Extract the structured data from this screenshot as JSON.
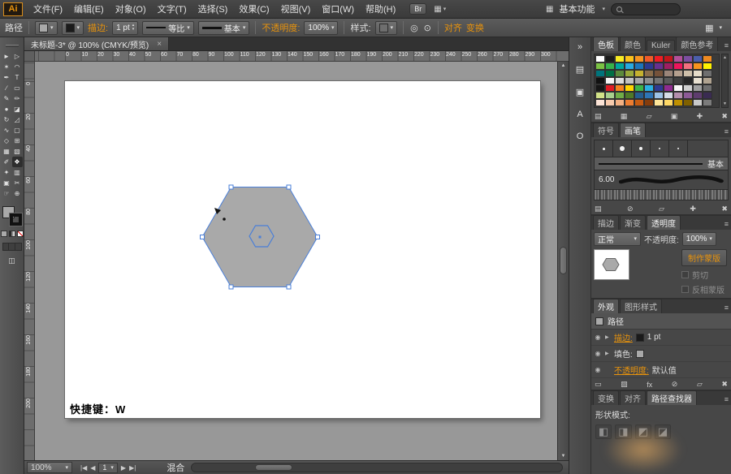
{
  "colors": {
    "accent_orange": "#e8930c",
    "selection_blue": "#4a7fd8",
    "pasteboard_gray": "#989898",
    "artboard_white": "#ffffff"
  },
  "icons": {
    "caret_down": "▾",
    "caret_up": "▴",
    "grid": "▦",
    "menu": "≡",
    "close": "×",
    "eye": "◉",
    "disclosure": "▶",
    "nav_first": "|◀",
    "nav_prev": "◀",
    "nav_next": "▶",
    "nav_last": "▶|",
    "scroll_up": "▲",
    "scroll_down": "▼",
    "isolate": "◎",
    "recolor": "⊙",
    "screen_mode": "◫"
  },
  "menubar": {
    "logo": "Ai",
    "items": [
      "文件(F)",
      "编辑(E)",
      "对象(O)",
      "文字(T)",
      "选择(S)",
      "效果(C)",
      "视图(V)",
      "窗口(W)",
      "帮助(H)"
    ],
    "br_button": "Br",
    "workspace": "基本功能"
  },
  "controlbar": {
    "context_label": "路径",
    "fill_swatch": "#a9a9a9",
    "stroke_swatch": "#1a1a1a",
    "stroke_label": "描边:",
    "stroke_weight": "1 pt",
    "profile_label": "等比",
    "brush_label": "基本",
    "opacity_label": "不透明度:",
    "opacity_value": "100%",
    "style_label": "样式:",
    "align_label": "对齐",
    "transform_label": "变换"
  },
  "toolbar": {
    "tools": [
      {
        "name": "selection-tool",
        "glyph": "►"
      },
      {
        "name": "direct-selection-tool",
        "glyph": "▷"
      },
      {
        "name": "magic-wand-tool",
        "glyph": "✶"
      },
      {
        "name": "lasso-tool",
        "glyph": "◠"
      },
      {
        "name": "pen-tool",
        "glyph": "✒"
      },
      {
        "name": "type-tool",
        "glyph": "T"
      },
      {
        "name": "line-segment-tool",
        "glyph": "∕"
      },
      {
        "name": "rectangle-tool",
        "glyph": "▭"
      },
      {
        "name": "paintbrush-tool",
        "glyph": "✎"
      },
      {
        "name": "pencil-tool",
        "glyph": "✏"
      },
      {
        "name": "blob-brush-tool",
        "glyph": "●"
      },
      {
        "name": "eraser-tool",
        "glyph": "◪"
      },
      {
        "name": "rotate-tool",
        "glyph": "↻"
      },
      {
        "name": "scale-tool",
        "glyph": "◿"
      },
      {
        "name": "width-tool",
        "glyph": "∿"
      },
      {
        "name": "free-transform-tool",
        "glyph": "▢"
      },
      {
        "name": "shape-builder-tool",
        "glyph": "◇"
      },
      {
        "name": "perspective-grid-tool",
        "glyph": "⊞"
      },
      {
        "name": "mesh-tool",
        "glyph": "▦"
      },
      {
        "name": "gradient-tool",
        "glyph": "▧"
      },
      {
        "name": "eyedropper-tool",
        "glyph": "✐"
      },
      {
        "name": "blend-tool",
        "glyph": "❖",
        "active": true
      },
      {
        "name": "symbol-sprayer-tool",
        "glyph": "✦"
      },
      {
        "name": "column-graph-tool",
        "glyph": "▥"
      },
      {
        "name": "artboard-tool",
        "glyph": "▣"
      },
      {
        "name": "slice-tool",
        "glyph": "✂"
      },
      {
        "name": "hand-tool",
        "glyph": "☞"
      },
      {
        "name": "zoom-tool",
        "glyph": "⊕"
      }
    ]
  },
  "document": {
    "tab_title": "未标题-3* @ 100% (CMYK/预览)",
    "shortcut_note": "快捷键：W",
    "hruler_numbers": [
      "0",
      "10",
      "20",
      "30",
      "40",
      "50",
      "60",
      "70",
      "80",
      "90",
      "100",
      "110",
      "120",
      "130",
      "140",
      "150",
      "160",
      "170",
      "180",
      "190",
      "200",
      "210",
      "220",
      "230",
      "240",
      "250",
      "260",
      "270",
      "280",
      "290",
      "300"
    ],
    "vruler_numbers": [
      "0",
      "20",
      "40",
      "60",
      "80",
      "100",
      "120",
      "140",
      "160",
      "180",
      "200"
    ]
  },
  "canvas": {
    "hexagon_fill": "#a9a9a9",
    "selection_color": "#4a7fd8",
    "cursor_color": "#111111"
  },
  "statusbar": {
    "zoom": "100%",
    "artboard_number": "1",
    "status_text": "混合"
  },
  "dock": {
    "strip_icons": [
      {
        "name": "expand-dock-icon",
        "glyph": "»"
      },
      {
        "name": "color-panel-icon",
        "glyph": "▤"
      },
      {
        "name": "brushes-panel-icon",
        "glyph": "▣"
      },
      {
        "name": "appearance-panel-icon",
        "glyph": "A"
      },
      {
        "name": "stroke-panel-icon",
        "glyph": "O"
      }
    ],
    "swatches": {
      "tabs": [
        "色板",
        "颜色",
        "Kuler",
        "颜色参考"
      ],
      "active_tab": "色板",
      "rows": [
        [
          "#ffffff",
          "#1c1c1c",
          "#f8ec24",
          "#fcc21b",
          "#f79422",
          "#f05a28",
          "#ee1d23",
          "#c2161b",
          "#b35099",
          "#7c4ea0",
          "#4b5fac",
          "#ee8a21"
        ],
        [
          "#7ac143",
          "#37b34a",
          "#00a79e",
          "#28aae1",
          "#1c75bb",
          "#2b3991",
          "#66308f",
          "#9e1e62",
          "#ed155b",
          "#f2707e",
          "#f7941e",
          "#fff200"
        ],
        [
          "#00747c",
          "#006f45",
          "#5c8a3c",
          "#98a83b",
          "#c5b12f",
          "#8a6d4b",
          "#75523a",
          "#9b8579",
          "#b5a08f",
          "#cebfa9",
          "#e7ddc9",
          "#6f6f6f"
        ],
        [
          "#111111",
          "#f5f5f5",
          "#dcdcdc",
          "#c2c2c2",
          "#a8a8a8",
          "#8e8e8e",
          "#747474",
          "#5a5a5a",
          "#404040",
          "#262626",
          "#e8e0d0",
          "#b0a390"
        ],
        [
          "#161616",
          "#e01b24",
          "#f58220",
          "#ffd400",
          "#3cb44a",
          "#2bb0e3",
          "#2e3a92",
          "#8f2b90",
          "#f9f9f9",
          "#cfcfcf",
          "#9f9f9f",
          "#6f6f6f"
        ],
        [
          "#d2e288",
          "#a8d08d",
          "#70ad47",
          "#4f7a28",
          "#255e91",
          "#2e75b6",
          "#9dc3e6",
          "#d6dce5",
          "#b48ead",
          "#8d5a97",
          "#5e3c6e",
          "#3a2b52"
        ],
        [
          "#fbe3d6",
          "#f8cbad",
          "#f4b183",
          "#ed7d31",
          "#c55a11",
          "#843c0c",
          "#ffe699",
          "#ffd966",
          "#bf9000",
          "#7f6000",
          "#c9c9c9",
          "#7b7b7b"
        ]
      ],
      "footer_icons": [
        {
          "name": "swatch-libraries-icon",
          "glyph": "▤"
        },
        {
          "name": "swatch-kinds-icon",
          "glyph": "▦"
        },
        {
          "name": "swatch-options-icon",
          "glyph": "▱"
        },
        {
          "name": "new-color-group-icon",
          "glyph": "▣"
        },
        {
          "name": "new-swatch-icon",
          "glyph": "✚"
        },
        {
          "name": "delete-swatch-icon",
          "glyph": "✖"
        }
      ]
    },
    "brushes": {
      "tabs": [
        "符号",
        "画笔"
      ],
      "active_tab": "画笔",
      "dot_sizes": [
        3,
        6,
        4,
        2,
        2
      ],
      "selected_brush": "基本",
      "calligraphic_brush": "6.00",
      "footer_icons": [
        {
          "name": "brush-libraries-icon",
          "glyph": "▤"
        },
        {
          "name": "remove-brush-stroke-icon",
          "glyph": "⊘"
        },
        {
          "name": "brush-options-icon",
          "glyph": "▱"
        },
        {
          "name": "new-brush-icon",
          "glyph": "✚"
        },
        {
          "name": "delete-brush-icon",
          "glyph": "✖"
        }
      ]
    },
    "transparency": {
      "tabs": [
        "描边",
        "渐变",
        "透明度"
      ],
      "active_tab": "透明度",
      "blend_mode": "正常",
      "opacity_label": "不透明度:",
      "opacity_value": "100%",
      "make_mask_button": "制作蒙版",
      "clip_label": "剪切",
      "invert_mask_label": "反相蒙版"
    },
    "appearance": {
      "tabs": [
        "外观",
        "图形样式"
      ],
      "active_tab": "外观",
      "object_label": "路径",
      "rows": [
        {
          "name": "stroke-row",
          "label": "描边:",
          "value": "1 pt",
          "swatch": "#1a1a1a",
          "link": true,
          "disclosure": true
        },
        {
          "name": "fill-row",
          "label": "填色:",
          "value": "",
          "swatch": "#a9a9a9",
          "link": false,
          "disclosure": true
        },
        {
          "name": "opacity-row",
          "label": "不透明度:",
          "value": "默认值",
          "link": true,
          "disclosure": false
        }
      ],
      "footer_icons": [
        {
          "name": "new-stroke-icon",
          "glyph": "▭"
        },
        {
          "name": "new-fill-icon",
          "glyph": "▨"
        },
        {
          "name": "new-effect-icon",
          "glyph": "fx"
        },
        {
          "name": "clear-appearance-icon",
          "glyph": "⊘"
        },
        {
          "name": "duplicate-item-icon",
          "glyph": "▱"
        },
        {
          "name": "delete-item-icon",
          "glyph": "✖"
        }
      ]
    },
    "pathfinder": {
      "tabs": [
        "变换",
        "对齐",
        "路径查找器"
      ],
      "active_tab": "路径查找器",
      "section_label": "形状模式:",
      "shape_mode_icons": [
        {
          "name": "unite-icon",
          "glyph": "◧"
        },
        {
          "name": "minus-front-icon",
          "glyph": "◨"
        },
        {
          "name": "intersect-icon",
          "glyph": "◩"
        },
        {
          "name": "exclude-icon",
          "glyph": "◪"
        }
      ]
    }
  }
}
